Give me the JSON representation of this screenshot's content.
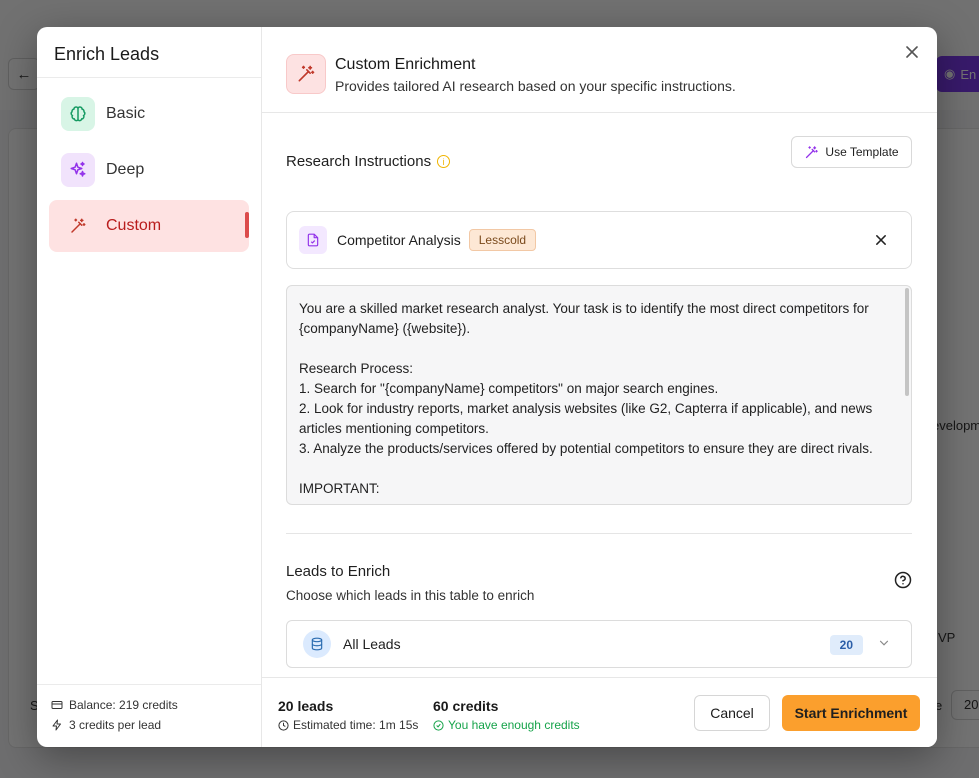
{
  "background": {
    "enrich_button_label": "En",
    "cell_a": "evelopm",
    "cell_b": "VP",
    "footer_left": "S",
    "footer_right": "e",
    "page_size": "20"
  },
  "modal": {
    "title": "Enrich Leads",
    "sidebar": {
      "items": [
        {
          "label": "Basic",
          "icon": "brain-icon",
          "active": false
        },
        {
          "label": "Deep",
          "icon": "sparkles-icon",
          "active": false
        },
        {
          "label": "Custom",
          "icon": "magic-wand-icon",
          "active": true
        }
      ],
      "balance": "Balance: 219 credits",
      "credits_per_lead": "3 credits per lead"
    },
    "header": {
      "title": "Custom Enrichment",
      "subtitle": "Provides tailored AI research based on your specific instructions."
    },
    "research": {
      "label": "Research Instructions",
      "use_template_label": "Use Template",
      "template": {
        "name": "Competitor Analysis",
        "badge": "Lesscold"
      },
      "instructions": "You are a skilled market research analyst. Your task is to identify the most direct competitors for {companyName} ({website}).\n\nResearch Process:\n1. Search for \"{companyName} competitors\" on major search engines.\n2. Look for industry reports, market analysis websites (like G2, Capterra if applicable), and news articles mentioning competitors.\n3. Analyze the products/services offered by potential competitors to ensure they are direct rivals.\n\nIMPORTANT:"
    },
    "leads": {
      "title": "Leads to Enrich",
      "subtitle": "Choose which leads in this table to enrich",
      "selected": "All Leads",
      "count": "20"
    },
    "footer": {
      "leads_count": "20 leads",
      "estimated_time": "Estimated time: 1m 15s",
      "credits": "60 credits",
      "credits_status": "You have enough credits",
      "cancel_label": "Cancel",
      "start_label": "Start Enrichment"
    }
  },
  "colors": {
    "primary": "#fb9f2d",
    "active_bg": "#fee2e2",
    "active_text": "#b91c1c",
    "success": "#16a34a"
  }
}
